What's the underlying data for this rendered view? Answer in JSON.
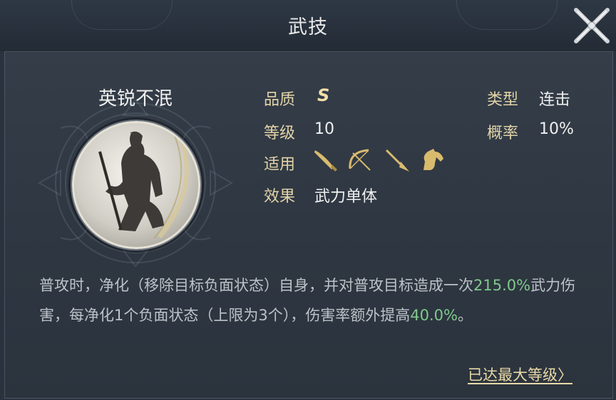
{
  "header": {
    "title": "武技"
  },
  "skill": {
    "name": "英锐不泯",
    "quality_label": "品质",
    "quality_value": "S",
    "level_label": "等级",
    "level_value": "10",
    "applies_label": "适用",
    "applies_icons": [
      "saber-icon",
      "bow-icon",
      "spear-icon",
      "horse-icon"
    ],
    "effect_label": "效果",
    "effect_value": "武力单体",
    "type_label": "类型",
    "type_value": "连击",
    "chance_label": "概率",
    "chance_value": "10%"
  },
  "description": {
    "part1": "普攻时，净化（移除目标负面状态）自身，并对普攻目标造成一次",
    "hl1": "215.0%",
    "part2": "武力伤害，每净化1个负面状态（上限为3个），伤害率额外提高",
    "hl2": "40.0%",
    "part3": "。"
  },
  "footer": {
    "max_level_label": "已达最大等级〉"
  },
  "colors": {
    "background": "#2a323d",
    "label_gold": "#e2d3a8",
    "highlight_green": "#7fc98c",
    "description_gray": "#bcc2c8",
    "weapon_icon_gold": "#d9bb6e"
  }
}
